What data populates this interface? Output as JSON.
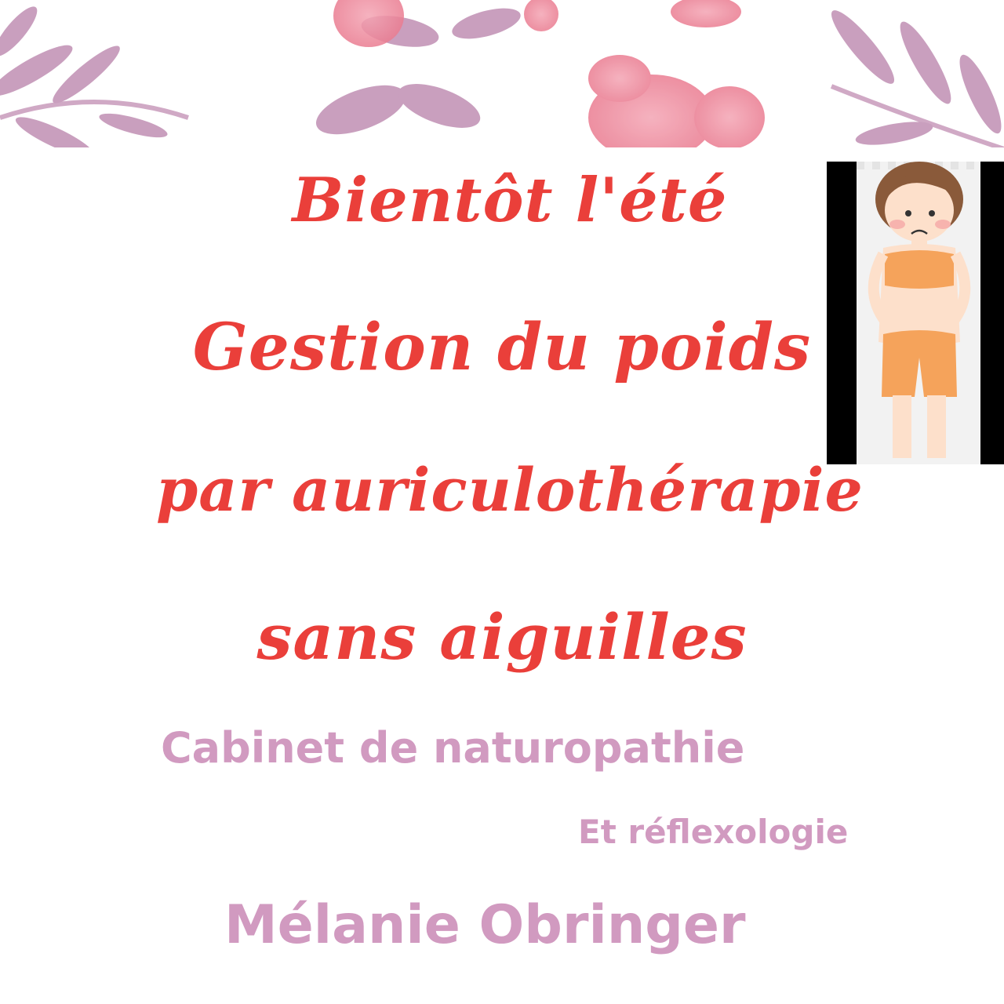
{
  "poster": {
    "title_lines": [
      "Bientôt l'été",
      "Gestion du poids",
      "par auriculothérapie",
      "sans aiguilles"
    ],
    "practice_line1": "Cabinet de naturopathie",
    "practice_line2": "Et réflexologie",
    "practitioner": "Mélanie Obringer"
  },
  "colors": {
    "title": "#ea3f3a",
    "subtitle": "#d19ac0",
    "leaf": "#b77fa8",
    "flower": "#ef8a9c"
  },
  "icons": {
    "banner": "watercolor-leaves-and-flowers",
    "photo": "cartoon-woman-worried-figure"
  }
}
